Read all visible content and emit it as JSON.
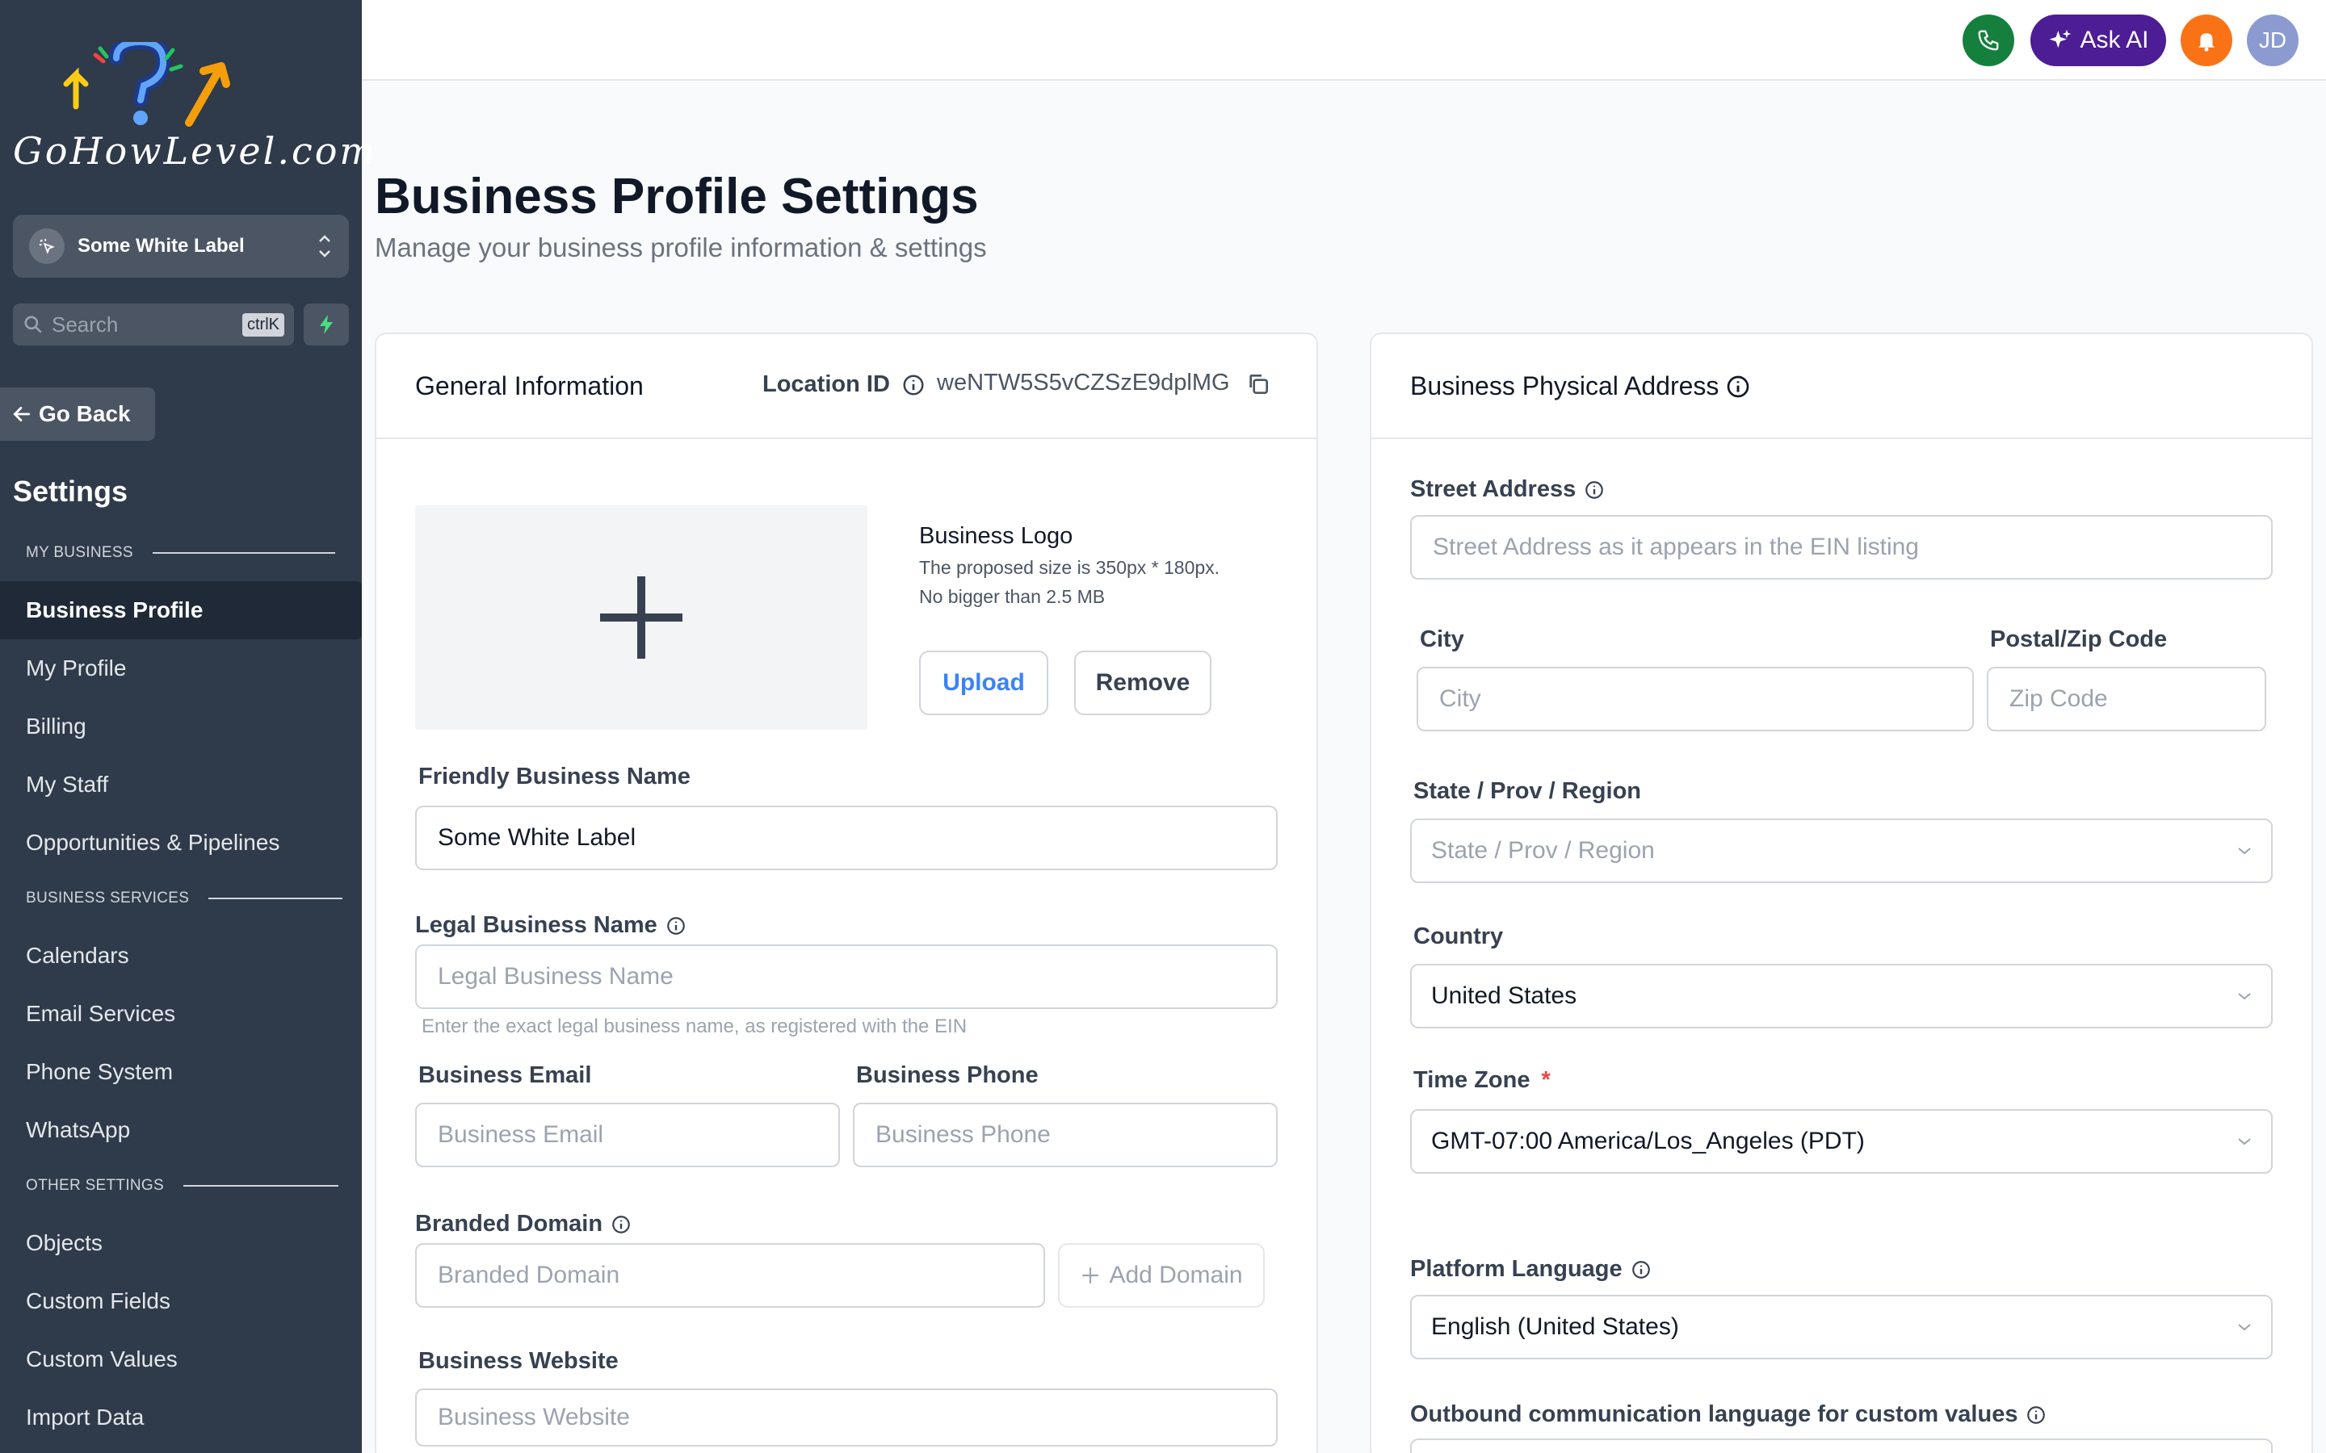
{
  "brand": {
    "logo_text": "GoHowLevel.com"
  },
  "sidebar": {
    "location_name": "Some White Label",
    "search_placeholder": "Search",
    "search_shortcut": "ctrlK",
    "go_back": "Go Back",
    "settings_title": "Settings",
    "sections": {
      "my_business": "MY BUSINESS",
      "business_services": "BUSINESS SERVICES",
      "other_settings": "OTHER SETTINGS"
    },
    "items": [
      {
        "label": "Business Profile",
        "active": true
      },
      {
        "label": "My Profile"
      },
      {
        "label": "Billing"
      },
      {
        "label": "My Staff"
      },
      {
        "label": "Opportunities & Pipelines"
      },
      {
        "label": "Calendars"
      },
      {
        "label": "Email Services"
      },
      {
        "label": "Phone System"
      },
      {
        "label": "WhatsApp"
      },
      {
        "label": "Objects"
      },
      {
        "label": "Custom Fields"
      },
      {
        "label": "Custom Values"
      },
      {
        "label": "Import Data"
      }
    ]
  },
  "topbar": {
    "ask_ai": "Ask AI",
    "avatar_initials": "JD"
  },
  "page": {
    "title": "Business Profile Settings",
    "subtitle": "Manage your business profile information & settings"
  },
  "general": {
    "title": "General Information",
    "location_id_label": "Location ID",
    "location_id_value": "weNTW5S5vCZSzE9dplMG",
    "logo_title": "Business Logo",
    "logo_desc_1": "The proposed size is 350px * 180px.",
    "logo_desc_2": "No bigger than 2.5 MB",
    "upload": "Upload",
    "remove": "Remove",
    "friendly_label": "Friendly Business Name",
    "friendly_value": "Some White Label",
    "legal_label": "Legal Business Name",
    "legal_placeholder": "Legal Business Name",
    "legal_hint": "Enter the exact legal business name, as registered with the EIN",
    "email_label": "Business Email",
    "email_placeholder": "Business Email",
    "phone_label": "Business Phone",
    "phone_placeholder": "Business Phone",
    "domain_label": "Branded Domain",
    "domain_placeholder": "Branded Domain",
    "add_domain": "Add Domain",
    "website_label": "Business Website",
    "website_placeholder": "Business Website"
  },
  "address": {
    "title": "Business Physical Address",
    "street_label": "Street Address",
    "street_placeholder": "Street Address as it appears in the EIN listing",
    "city_label": "City",
    "city_placeholder": "City",
    "zip_label": "Postal/Zip Code",
    "zip_placeholder": "Zip Code",
    "state_label": "State / Prov / Region",
    "state_placeholder": "State / Prov / Region",
    "country_label": "Country",
    "country_value": "United States",
    "tz_label": "Time Zone",
    "tz_required": "*",
    "tz_value": "GMT-07:00 America/Los_Angeles (PDT)",
    "lang_label": "Platform Language",
    "lang_value": "English (United States)",
    "outbound_label": "Outbound communication language for custom values"
  }
}
